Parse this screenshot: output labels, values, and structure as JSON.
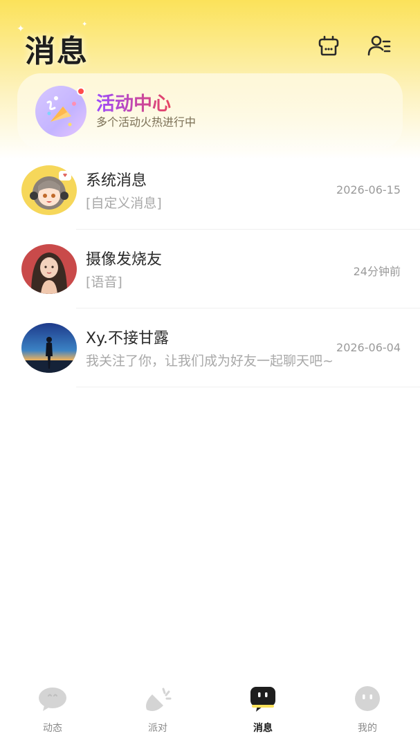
{
  "header": {
    "title": "消息",
    "icons": [
      "shop-icon",
      "contacts-icon"
    ]
  },
  "activity": {
    "title": "活动中心",
    "subtitle": "多个活动火热进行中",
    "icon": "party-popper-icon",
    "has_dot": true
  },
  "messages": [
    {
      "name": "系统消息",
      "preview": "[自定义消息]",
      "time": "2026-06-15",
      "avatar": "anime-girl-avatar"
    },
    {
      "name": "摄像发烧友",
      "preview": "[语音]",
      "time": "24分钟前",
      "avatar": "woman-portrait-avatar"
    },
    {
      "name": "Xy.不接甘露",
      "preview": "我关注了你，让我们成为好友一起聊天吧~",
      "time": "2026-06-04",
      "avatar": "sunset-silhouette-avatar"
    }
  ],
  "tabs": [
    {
      "label": "动态",
      "icon": "bubble-icon",
      "active": false
    },
    {
      "label": "派对",
      "icon": "party-horn-icon",
      "active": false
    },
    {
      "label": "消息",
      "icon": "message-icon",
      "active": true
    },
    {
      "label": "我的",
      "icon": "face-icon",
      "active": false
    }
  ],
  "colors": {
    "accent_yellow": "#fbe25a",
    "badge_red": "#ff4b4b",
    "activity_purple": "#9b4bff"
  }
}
